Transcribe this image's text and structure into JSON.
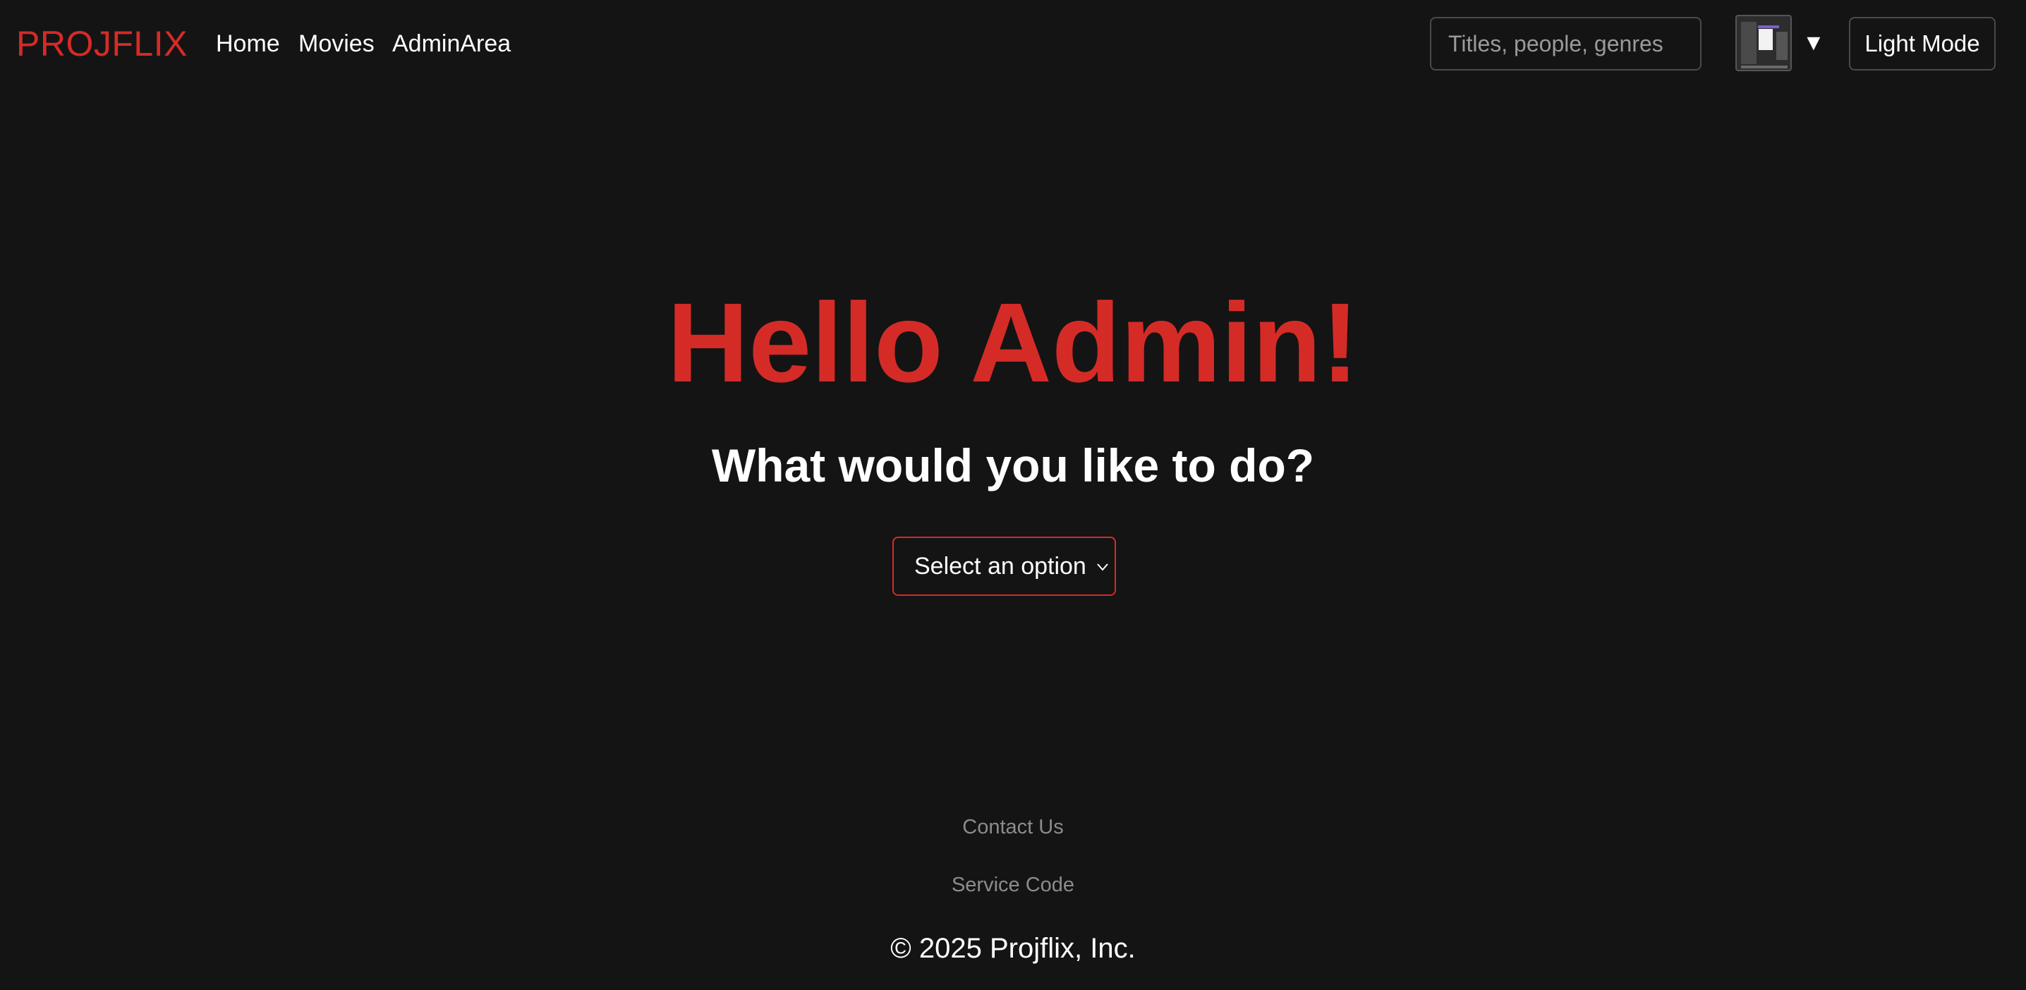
{
  "header": {
    "logo": "PROJFLIX",
    "nav": [
      {
        "label": "Home"
      },
      {
        "label": "Movies"
      },
      {
        "label": "AdminArea"
      }
    ],
    "search": {
      "placeholder": "Titles, people, genres",
      "value": ""
    },
    "profile_caret": "▼",
    "theme_toggle_label": "Light Mode"
  },
  "main": {
    "greeting": "Hello Admin!",
    "question": "What would you like to do?",
    "select": {
      "selected": "Select an option"
    }
  },
  "footer": {
    "links": [
      {
        "label": "Contact Us"
      },
      {
        "label": "Service Code"
      }
    ],
    "copyright": "© 2025 Projflix, Inc."
  },
  "colors": {
    "background": "#141414",
    "brand": "#d52b27",
    "text": "#ffffff",
    "muted": "#8c8c8c",
    "border": "#4a4a4a"
  },
  "icons": {
    "profile": "avatar-thumbnail",
    "caret": "triangle-down-icon",
    "select": "chevron-down-icon"
  }
}
